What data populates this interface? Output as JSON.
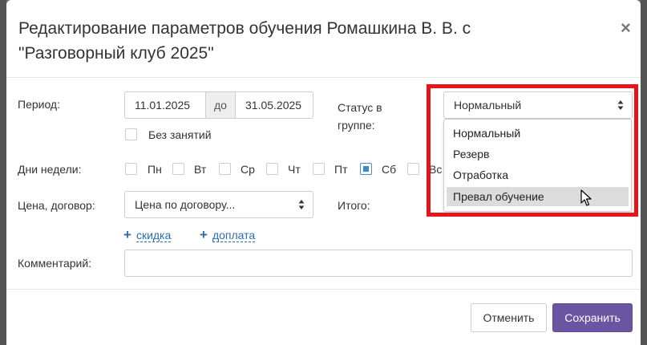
{
  "dialog": {
    "title": "Редактирование параметров обучения Ромашкина В. В. с \"Разговорный клуб 2025\"",
    "close_label": "×"
  },
  "period": {
    "label": "Период:",
    "from": "11.01.2025",
    "separator": "до",
    "to": "31.05.2025",
    "no_classes_label": "Без занятий",
    "no_classes_checked": false
  },
  "status": {
    "label": "Статус в группе:",
    "selected": "Нормальный",
    "options": [
      "Нормальный",
      "Резерв",
      "Отработка",
      "Превал обучение"
    ],
    "hovered_index": 3
  },
  "weekdays": {
    "label": "Дни недели:",
    "days": [
      {
        "label": "Пн",
        "checked": false
      },
      {
        "label": "Вт",
        "checked": false
      },
      {
        "label": "Ср",
        "checked": false
      },
      {
        "label": "Чт",
        "checked": false
      },
      {
        "label": "Пт",
        "checked": false
      },
      {
        "label": "Сб",
        "checked": true
      },
      {
        "label": "Вс",
        "checked": false
      }
    ]
  },
  "price": {
    "label": "Цена, договор:",
    "selected": "Цена по договору...",
    "total_label": "Итого:",
    "discount_link": "скидка",
    "surcharge_link": "доплата"
  },
  "comment": {
    "label": "Комментарий:",
    "value": ""
  },
  "footer": {
    "cancel_label": "Отменить",
    "save_label": "Сохранить"
  },
  "colors": {
    "primary": "#6a55a3",
    "highlight": "#e8141c",
    "link": "#2a6db0"
  }
}
